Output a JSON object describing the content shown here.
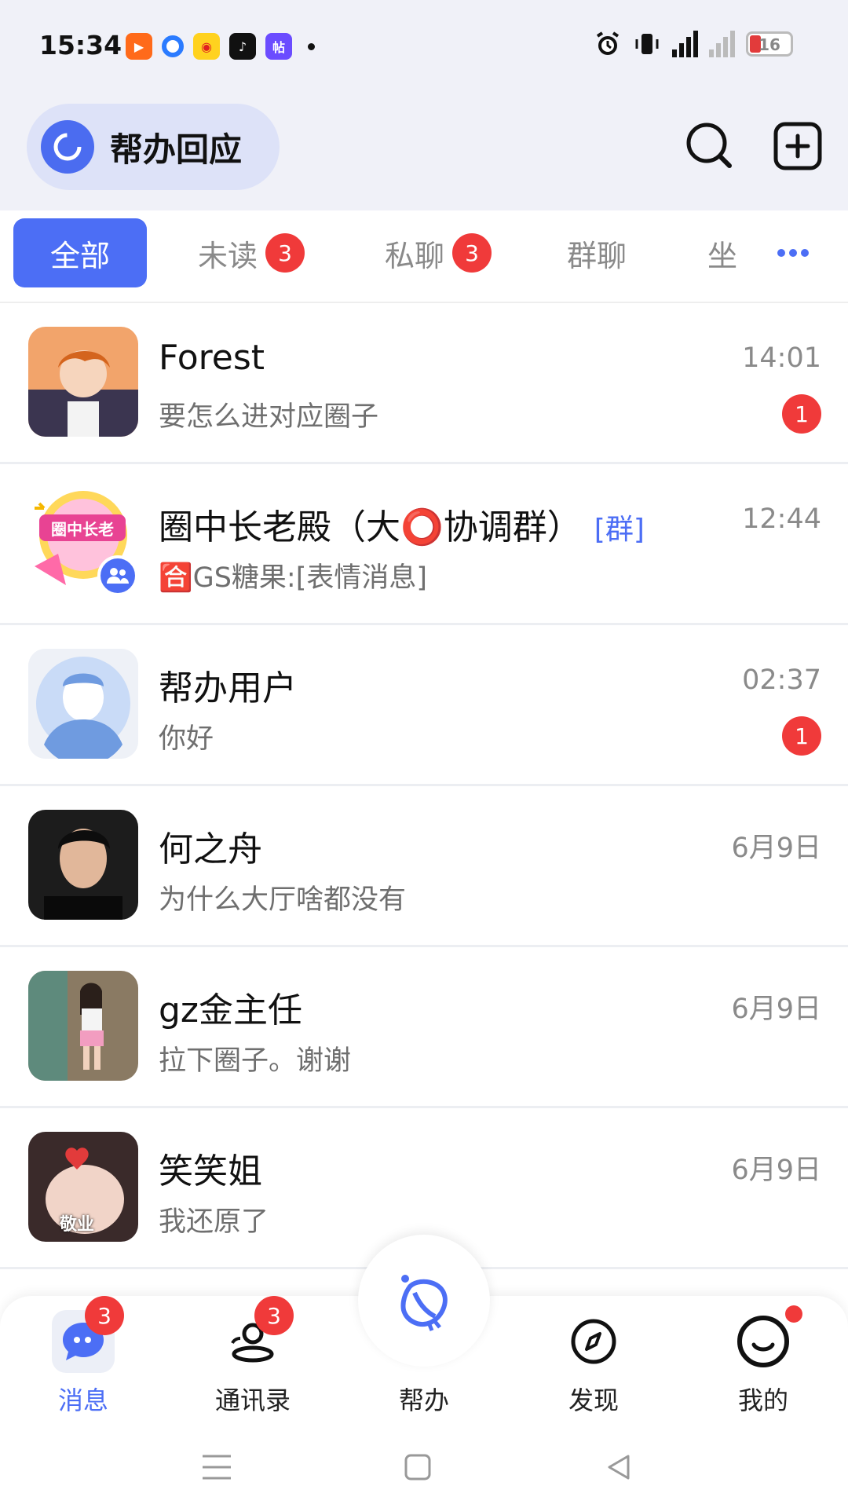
{
  "status_bar": {
    "time": "15:34",
    "battery": "16",
    "app_icons": [
      "kuaishou-icon",
      "browser-icon",
      "weibo-icon",
      "douyin-icon",
      "tieba-icon"
    ],
    "system_icons": [
      "alarm-icon",
      "vibrate-icon",
      "signal-5g-icon",
      "signal-icon",
      "battery-icon"
    ]
  },
  "header": {
    "title": "帮办回应",
    "icons": [
      "search-icon",
      "add-icon"
    ]
  },
  "tabs": [
    {
      "label": "全部",
      "active": true
    },
    {
      "label": "未读",
      "badge": "3"
    },
    {
      "label": "私聊",
      "badge": "3"
    },
    {
      "label": "群聊"
    },
    {
      "label": "坐"
    }
  ],
  "conversations": [
    {
      "name": "Forest",
      "tag": "",
      "message": "要怎么进对应圈子",
      "time": "14:01",
      "unread": "1"
    },
    {
      "name": "圈中长老殿（大⭕协调群）",
      "tag": "[群]",
      "message": "🈴GS糖果:[表情消息]",
      "time": "12:44",
      "unread": "",
      "avatar_text": "圈中长老"
    },
    {
      "name": "帮办用户",
      "tag": "",
      "message": "你好",
      "time": "02:37",
      "unread": "1"
    },
    {
      "name": "何之舟",
      "tag": "",
      "message": "为什么大厅啥都没有",
      "time": "6月9日",
      "unread": ""
    },
    {
      "name": "gz金主任",
      "tag": "",
      "message": "拉下圈子。谢谢",
      "time": "6月9日",
      "unread": ""
    },
    {
      "name": "笑笑姐",
      "tag": "",
      "message": "我还原了",
      "time": "6月9日",
      "unread": "",
      "avatar_text": "敬业"
    }
  ],
  "bottom_nav": [
    {
      "label": "消息",
      "badge": "3",
      "active": true
    },
    {
      "label": "通讯录",
      "badge": "3"
    },
    {
      "label": "帮办"
    },
    {
      "label": "发现"
    },
    {
      "label": "我的",
      "dot": true
    }
  ],
  "colors": {
    "accent": "#4c6ef5",
    "badge": "#f03a3a",
    "header_bg": "#f0f1f8"
  }
}
